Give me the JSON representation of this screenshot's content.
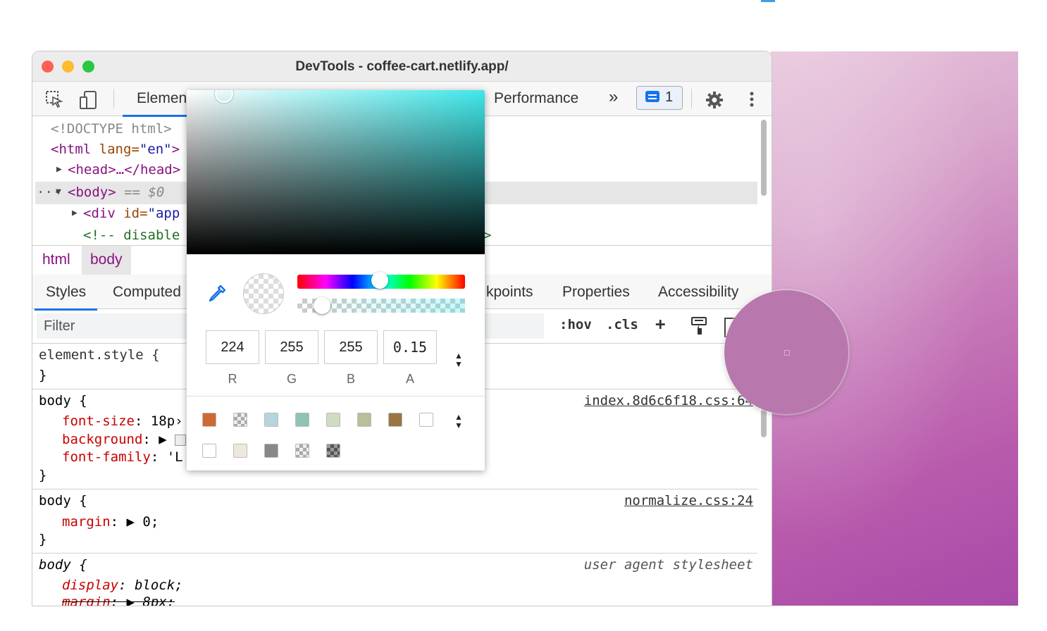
{
  "window": {
    "title": "DevTools - coffee-cart.netlify.app/"
  },
  "toolbar": {
    "tab_elements": "Elemen",
    "tab_performance": "Performance",
    "more_tabs": "»",
    "issues_count": "1"
  },
  "dom": {
    "doctype": "<!DOCTYPE html>",
    "html_open_tag": "<html",
    "html_attr": " lang=",
    "html_attr_val": "\"en\"",
    "html_close": ">",
    "head": "<head>…</head>",
    "ellipsis": "···",
    "body": "<body>",
    "body_eq": " == $0",
    "div_tag": "<div",
    "div_attr": " id=",
    "div_val": "\"app",
    "comment": "<!-- disable",
    "comment_tail": ">"
  },
  "breadcrumbs": {
    "items": [
      "html",
      "body"
    ]
  },
  "styles_tabs": {
    "styles": "Styles",
    "computed": "Computed",
    "breakpoints": "kpoints",
    "properties": "Properties",
    "accessibility": "Accessibility"
  },
  "filter": {
    "placeholder": "Filter",
    "hov": ":hov",
    "cls": ".cls",
    "add": "+"
  },
  "rules": [
    {
      "selector": "element.style {",
      "close": "}"
    },
    {
      "selector": "body {",
      "source": "index.8d6c6f18.css:64",
      "props": [
        {
          "name": "font-size",
          "value": " 18p›"
        },
        {
          "name": "background",
          "value": " ▶ "
        },
        {
          "name": "font-family",
          "value": " 'L"
        }
      ],
      "close": "}"
    },
    {
      "selector": "body {",
      "source": "normalize.css:24",
      "props": [
        {
          "name": "margin",
          "value": " ▶ 0;"
        }
      ],
      "close": "}"
    },
    {
      "selector": "body {",
      "source": "user agent stylesheet",
      "props": [
        {
          "name": "display",
          "value": " block;"
        },
        {
          "name": "margin",
          "value": " ▶ 8px;"
        }
      ]
    }
  ],
  "color_picker": {
    "r": "224",
    "g": "255",
    "b": "255",
    "a": "0.15",
    "labels": [
      "R",
      "G",
      "B",
      "A"
    ],
    "palette_row1": [
      "#d06a33",
      "check",
      "#b7d4dc",
      "#8fc3b5",
      "#cfdcbf",
      "#b8c09a",
      "#9a7542",
      "#ffffff"
    ],
    "palette_row2": [
      "#ffffff",
      "#eeeadb",
      "#888888",
      "check",
      "check2"
    ]
  },
  "colors": {
    "accent": "#1a73e8",
    "tag": "#881280",
    "prop": "#c80000"
  }
}
